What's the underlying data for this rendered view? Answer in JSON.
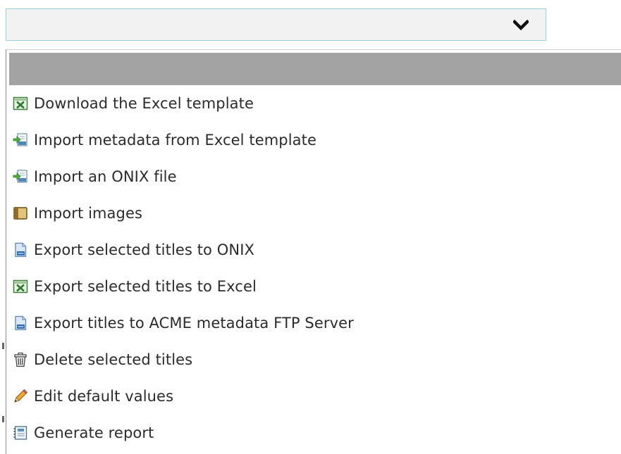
{
  "select": {
    "value": "",
    "chevron_icon": "chevron-down-icon"
  },
  "dropdown": {
    "header_label": "",
    "items": [
      {
        "label": "Download the Excel template",
        "icon": "excel-icon"
      },
      {
        "label": "Import metadata from Excel template",
        "icon": "import-arrow-icon"
      },
      {
        "label": "Import an ONIX file",
        "icon": "import-arrow-icon"
      },
      {
        "label": "Import images",
        "icon": "archive-folder-icon"
      },
      {
        "label": "Export selected titles to ONIX",
        "icon": "xml-file-icon"
      },
      {
        "label": "Export selected titles to Excel",
        "icon": "excel-icon"
      },
      {
        "label": "Export titles to ACME metadata FTP Server",
        "icon": "xml-file-icon"
      },
      {
        "label": "Delete selected titles",
        "icon": "trash-icon"
      },
      {
        "label": "Edit default values",
        "icon": "pencil-icon"
      },
      {
        "label": "Generate report",
        "icon": "report-icon"
      }
    ]
  },
  "colors": {
    "select_border": "#9ccfdc",
    "select_bg": "#f2f2f2",
    "header_bg": "#a3a3a3",
    "text": "#2b2b2b"
  }
}
